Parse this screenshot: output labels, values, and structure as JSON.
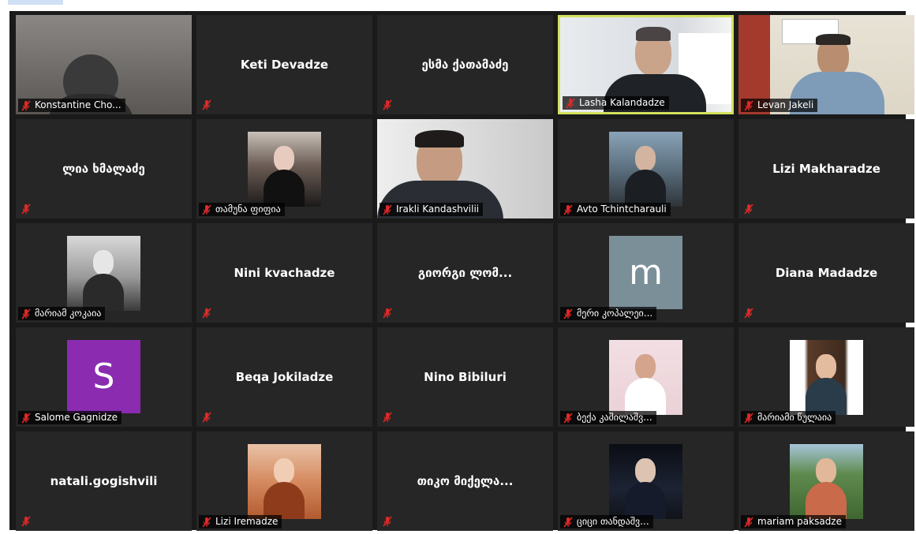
{
  "participants": [
    {
      "name": "Konstantine Cho...",
      "kind": "video",
      "scene": "dim-room"
    },
    {
      "name": "Keti Devadze",
      "kind": "name"
    },
    {
      "name": "ესმა ქათამაძე",
      "kind": "name"
    },
    {
      "name": "Lasha Kalandadze",
      "kind": "video",
      "scene": "office-man",
      "active": true
    },
    {
      "name": "Levan Jakeli",
      "kind": "video",
      "scene": "office-man-2"
    },
    {
      "name": "ლია ხმალაძე",
      "kind": "name"
    },
    {
      "name": "თამუნა ფიფია",
      "kind": "photo",
      "scene": "portrait-dark"
    },
    {
      "name": "Irakli Kandashvilii",
      "kind": "video",
      "scene": "man-suit"
    },
    {
      "name": "Avto Tchintcharauli",
      "kind": "photo",
      "scene": "portrait-tree"
    },
    {
      "name": "Lizi Makharadze",
      "kind": "name"
    },
    {
      "name": "მარიამ კოკაია",
      "kind": "photo",
      "scene": "portrait-bw"
    },
    {
      "name": "Nini kvachadze",
      "kind": "name"
    },
    {
      "name": "გიორგი ლომ...",
      "kind": "name"
    },
    {
      "name": "მერი კოპალეი...",
      "kind": "avatar",
      "letter": "m",
      "color": "#7b8f99"
    },
    {
      "name": "Diana Madadze",
      "kind": "name"
    },
    {
      "name": "Salome Gagnidze",
      "kind": "avatar",
      "letter": "S",
      "color": "#8a2bb0"
    },
    {
      "name": "Beqa Jokiladze",
      "kind": "name"
    },
    {
      "name": "Nino Bibiluri",
      "kind": "name"
    },
    {
      "name": "ბექა კაშილაშვ...",
      "kind": "photo",
      "scene": "portrait-pink"
    },
    {
      "name": "მარიამი წულაია",
      "kind": "photo",
      "scene": "portrait-white"
    },
    {
      "name": "natali.gogishvili",
      "kind": "name"
    },
    {
      "name": "Lizi Iremadze",
      "kind": "photo",
      "scene": "portrait-red"
    },
    {
      "name": "თიკო მიქელა...",
      "kind": "name"
    },
    {
      "name": "ციცი თანდაშვ...",
      "kind": "photo",
      "scene": "portrait-night"
    },
    {
      "name": "mariam paksadze",
      "kind": "photo",
      "scene": "portrait-green"
    }
  ],
  "colors": {
    "background": "#1a1a1a",
    "tile": "#262626",
    "active_border": "#d4e15d",
    "muted_mic": "#e02828"
  },
  "icons": {
    "muted": "muted-mic-icon"
  }
}
